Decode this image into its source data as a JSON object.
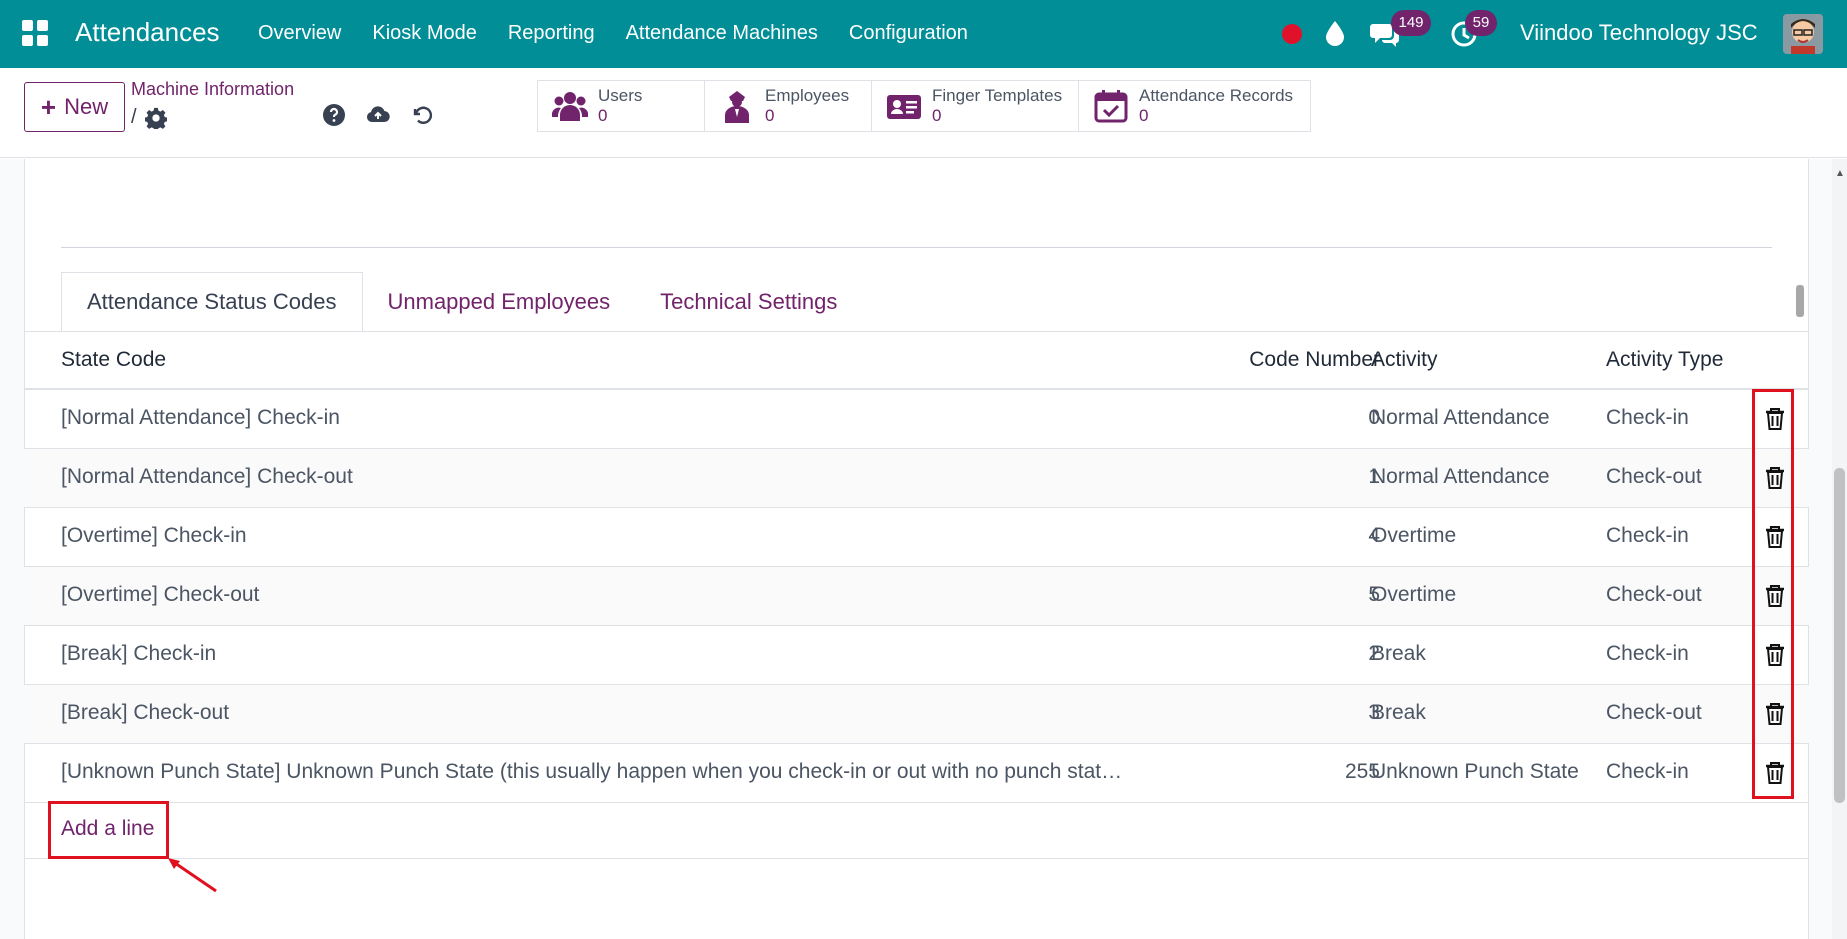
{
  "navbar": {
    "app_title": "Attendances",
    "menu": [
      "Overview",
      "Kiosk Mode",
      "Reporting",
      "Attendance Machines",
      "Configuration"
    ],
    "messages_count": "149",
    "activities_count": "59",
    "company": "Viindoo Technology JSC",
    "accent": "#018e96"
  },
  "control": {
    "new_label": "New",
    "breadcrumb_title": "Machine Information",
    "breadcrumb_sep": "/",
    "stats": [
      {
        "label": "Users",
        "value": "0",
        "icon": "users-icon"
      },
      {
        "label": "Employees",
        "value": "0",
        "icon": "employee-icon"
      },
      {
        "label": "Finger Templates",
        "value": "0",
        "icon": "id-card-icon"
      },
      {
        "label": "Attendance Records",
        "value": "0",
        "icon": "calendar-check-icon"
      }
    ]
  },
  "tabs": [
    "Attendance Status Codes",
    "Unmapped Employees",
    "Technical Settings"
  ],
  "table": {
    "headers": {
      "state": "State Code",
      "number": "Code Number",
      "activity": "Activity",
      "type": "Activity Type"
    },
    "rows": [
      {
        "state": "[Normal Attendance] Check-in",
        "number": "0",
        "activity": "Normal Attendance",
        "type": "Check-in"
      },
      {
        "state": "[Normal Attendance] Check-out",
        "number": "1",
        "activity": "Normal Attendance",
        "type": "Check-out"
      },
      {
        "state": "[Overtime] Check-in",
        "number": "4",
        "activity": "Overtime",
        "type": "Check-in"
      },
      {
        "state": "[Overtime] Check-out",
        "number": "5",
        "activity": "Overtime",
        "type": "Check-out"
      },
      {
        "state": "[Break] Check-in",
        "number": "2",
        "activity": "Break",
        "type": "Check-in"
      },
      {
        "state": "[Break] Check-out",
        "number": "3",
        "activity": "Break",
        "type": "Check-out"
      },
      {
        "state": "[Unknown Punch State] Unknown Punch State (this usually happen when you check-in or out with no punch stat…",
        "number": "255",
        "activity": "Unknown Punch State",
        "type": "Check-in"
      }
    ],
    "add_line": "Add a line"
  }
}
